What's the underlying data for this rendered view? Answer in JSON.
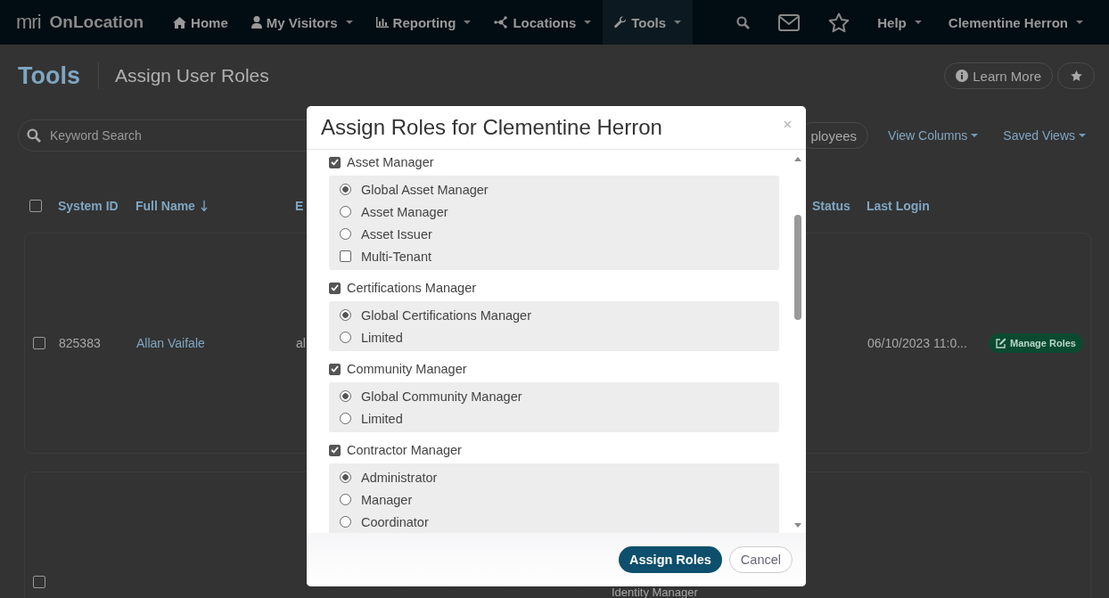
{
  "nav": {
    "logo": "mri",
    "brand": "OnLocation",
    "items": [
      {
        "label": "Home",
        "dropdown": false,
        "selected": false
      },
      {
        "label": "My Visitors",
        "dropdown": true,
        "selected": false
      },
      {
        "label": "Reporting",
        "dropdown": true,
        "selected": false
      },
      {
        "label": "Locations",
        "dropdown": true,
        "selected": false
      },
      {
        "label": "Tools",
        "dropdown": true,
        "selected": true
      }
    ],
    "help": "Help",
    "user": "Clementine Herron"
  },
  "header": {
    "title": "Tools",
    "subtitle": "Assign User Roles",
    "learn_more": "Learn More"
  },
  "toolbar": {
    "search": {
      "placeholder": "Keyword Search"
    },
    "employees": "ployees",
    "view_columns": "View Columns",
    "saved_views": "Saved Views"
  },
  "table": {
    "all_selected": false,
    "columns": [
      {
        "label": "System ID",
        "sorted": false
      },
      {
        "label": "Full Name",
        "sorted": true
      },
      {
        "label": "E",
        "sorted": false
      },
      {
        "label": "Status",
        "sorted": false
      },
      {
        "label": "Last Login",
        "sorted": false
      }
    ],
    "rows": [
      {
        "selected": false,
        "system_id": "825383",
        "full_name": "Allan Vaifale",
        "email": "al",
        "last_login": "06/10/2023 11:0...",
        "action": "Manage Roles"
      },
      {
        "selected": false,
        "role": "Identity Manager"
      }
    ]
  },
  "modal": {
    "title": "Assign Roles for Clementine Herron",
    "groups": [
      {
        "label": "Asset Manager",
        "checked": true,
        "options": [
          {
            "kind": "radio",
            "label": "Global Asset Manager",
            "selected": true
          },
          {
            "kind": "radio",
            "label": "Asset Manager",
            "selected": false
          },
          {
            "kind": "radio",
            "label": "Asset Issuer",
            "selected": false
          },
          {
            "kind": "checkbox",
            "label": "Multi-Tenant",
            "selected": false
          }
        ]
      },
      {
        "label": "Certifications Manager",
        "checked": true,
        "options": [
          {
            "kind": "radio",
            "label": "Global Certifications Manager",
            "selected": true
          },
          {
            "kind": "radio",
            "label": "Limited",
            "selected": false
          }
        ]
      },
      {
        "label": "Community Manager",
        "checked": true,
        "options": [
          {
            "kind": "radio",
            "label": "Global Community Manager",
            "selected": true
          },
          {
            "kind": "radio",
            "label": "Limited",
            "selected": false
          }
        ]
      },
      {
        "label": "Contractor Manager",
        "checked": true,
        "options": [
          {
            "kind": "radio",
            "label": "Administrator",
            "selected": true
          },
          {
            "kind": "radio",
            "label": "Manager",
            "selected": false
          },
          {
            "kind": "radio",
            "label": "Coordinator",
            "selected": false
          }
        ]
      }
    ],
    "primary": "Assign Roles",
    "secondary": "Cancel"
  }
}
